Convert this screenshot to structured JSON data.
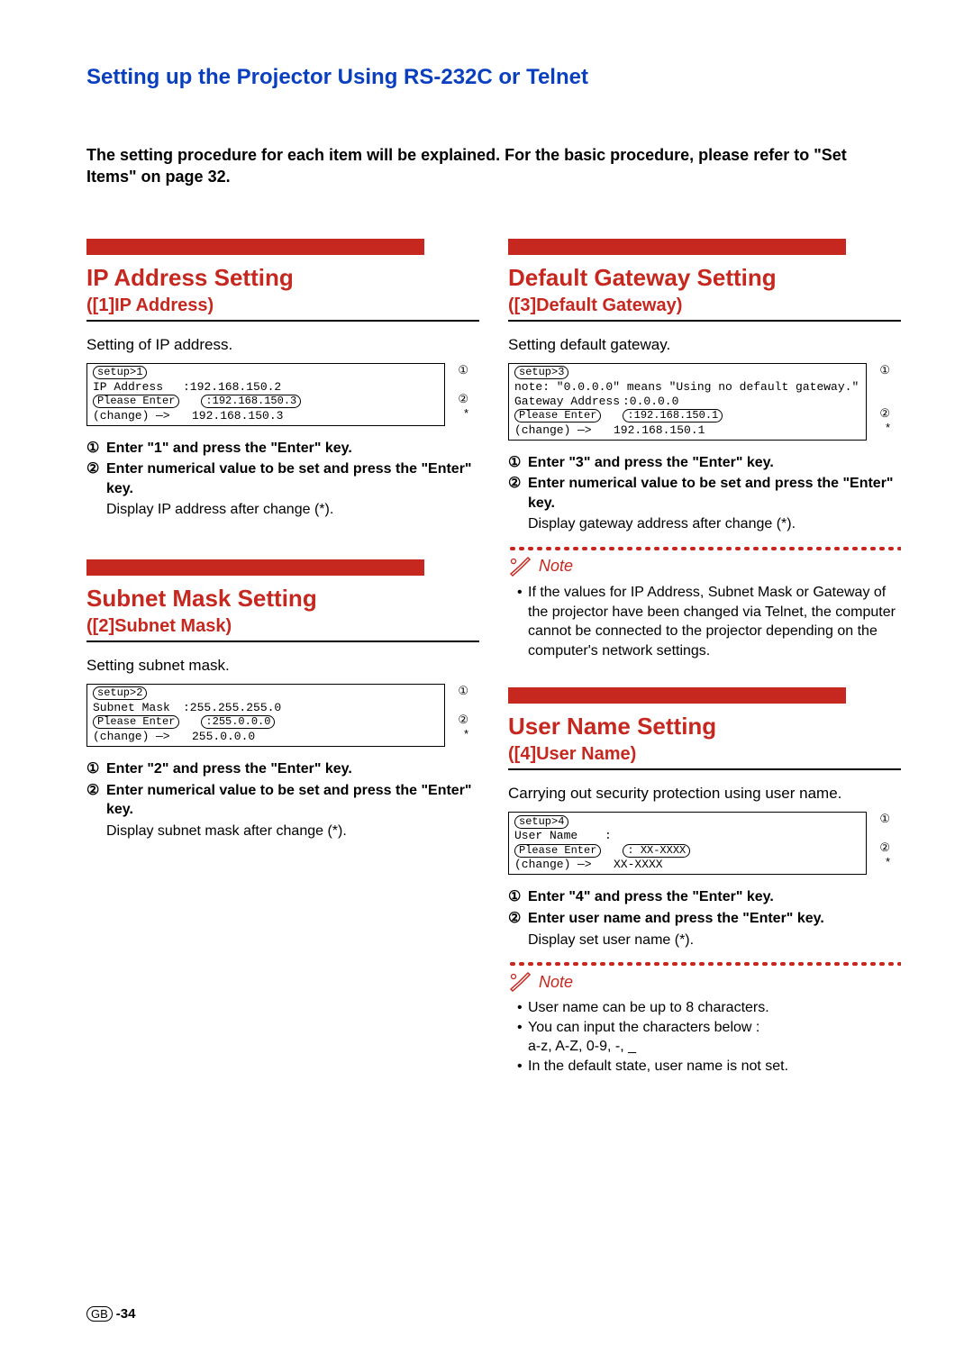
{
  "title": "Setting up the Projector Using RS-232C or Telnet",
  "intro_a": "The setting procedure for each item will be explained. For the basic procedure, please refer to \"Set Items\" on page ",
  "intro_b": "32",
  "intro_c": ".",
  "footer": {
    "gb": "GB",
    "page": "-34"
  },
  "ip": {
    "title": "IP Address Setting",
    "sub": "([1]IP Address)",
    "desc": "Setting of IP address.",
    "term": {
      "setup": "setup>1",
      "r1a": "IP Address",
      "r1b": ":192.168.150.2",
      "r2a": "Please Enter",
      "r2b": ":192.168.150.3",
      "r3a": "(change)",
      "r3arrow": "—>",
      "r3b": "192.168.150.3",
      "m1": "①",
      "m2": "②",
      "m3": "*"
    },
    "steps": {
      "n1": "①",
      "t1": "Enter \"1\" and press the \"Enter\" key.",
      "n2": "②",
      "t2": "Enter numerical value to be set and press the \"Enter\" key.",
      "t3": "Display IP address after change (*)."
    }
  },
  "sm": {
    "title": "Subnet Mask Setting",
    "sub": "([2]Subnet Mask)",
    "desc": "Setting subnet mask.",
    "term": {
      "setup": "setup>2",
      "r1a": "Subnet Mask",
      "r1b": ":255.255.255.0",
      "r2a": "Please Enter",
      "r2b": ":255.0.0.0",
      "r3a": "(change)",
      "r3arrow": "—>",
      "r3b": "255.0.0.0",
      "m1": "①",
      "m2": "②",
      "m3": "*"
    },
    "steps": {
      "n1": "①",
      "t1": "Enter \"2\" and press the \"Enter\" key.",
      "n2": "②",
      "t2": "Enter numerical value to be set and press the \"Enter\" key.",
      "t3": "Display subnet mask after change (*)."
    }
  },
  "gw": {
    "title": "Default Gateway Setting",
    "sub": "([3]Default Gateway)",
    "desc": "Setting default gateway.",
    "term": {
      "setup": "setup>3",
      "note": "note: \"0.0.0.0\" means \"Using no default gateway.\"",
      "r1a": "Gateway Address",
      "r1b": ":0.0.0.0",
      "r2a": "Please Enter",
      "r2b": ":192.168.150.1",
      "r3a": "(change)",
      "r3arrow": "—>",
      "r3b": "192.168.150.1",
      "m1": "①",
      "m2": "②",
      "m3": "*"
    },
    "steps": {
      "n1": "①",
      "t1": "Enter \"3\" and press the \"Enter\" key.",
      "n2": "②",
      "t2": "Enter numerical value to be set and press the \"Enter\" key.",
      "t3": "Display gateway address after change (*)."
    },
    "note1": "If the values for IP Address, Subnet Mask or Gateway of the projector have been changed via Telnet, the computer cannot be connected to the projector depending on the computer's network settings."
  },
  "un": {
    "title": "User Name Setting",
    "sub": "([4]User Name)",
    "desc": "Carrying out security protection using user name.",
    "term": {
      "setup": "setup>4",
      "r1a": "User Name",
      "r1b": ":",
      "r2a": "Please Enter",
      "r2b": ": XX-XXXX",
      "r3a": "(change)",
      "r3arrow": "—>",
      "r3b": "XX-XXXX",
      "m1": "①",
      "m2": "②",
      "m3": "*"
    },
    "steps": {
      "n1": "①",
      "t1": "Enter \"4\" and press the \"Enter\" key.",
      "n2": "②",
      "t2": "Enter user name and press the \"Enter\" key.",
      "t3": "Display set user name (*)."
    },
    "noteA": "User name can be up to 8 characters.",
    "noteB1": "You can input the characters below :",
    "noteB2": "a-z, A-Z, 0-9, -, _",
    "noteC": "In the default state, user name is not set."
  },
  "notelabel": "Note"
}
